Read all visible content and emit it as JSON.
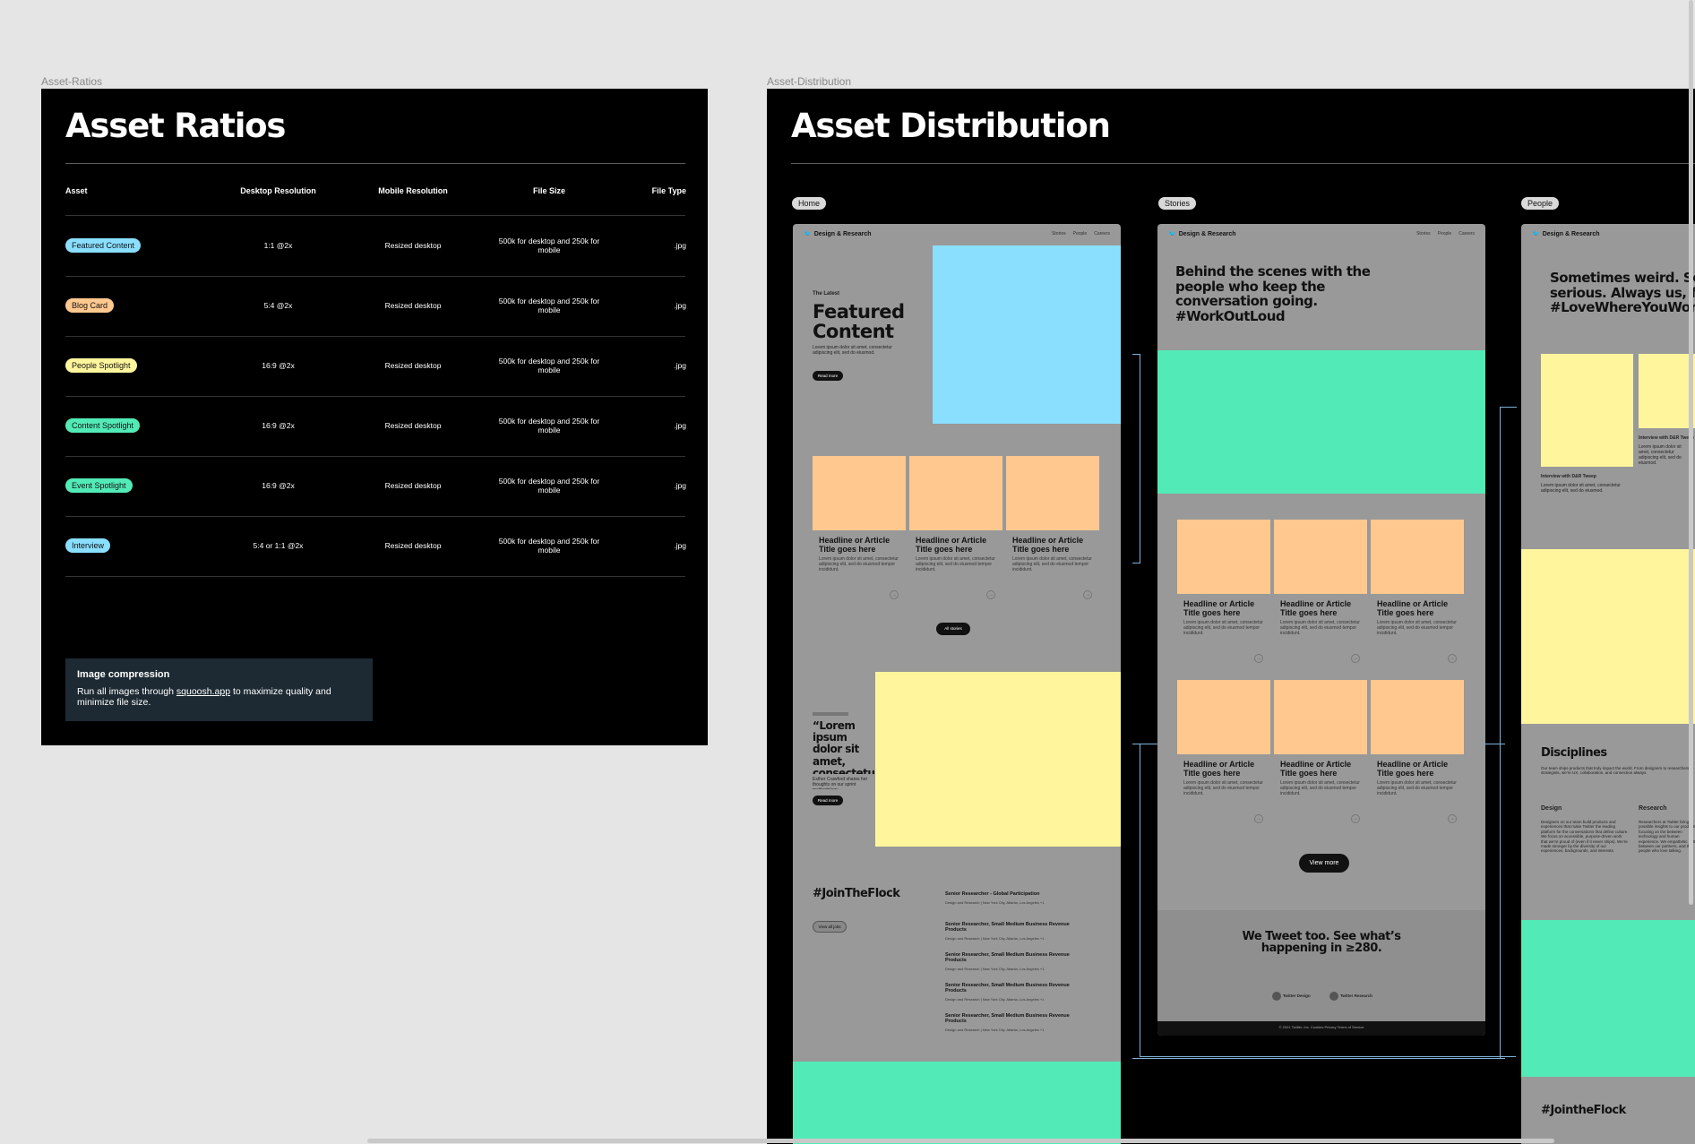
{
  "ratios_frame": {
    "label": "Asset-Ratios",
    "title": "Asset Ratios",
    "columns": [
      "Asset",
      "Desktop Resolution",
      "Mobile Resolution",
      "File Size",
      "File Type"
    ],
    "rows": [
      {
        "asset": "Featured Content",
        "color": "#8adfff",
        "desktop": "1:1 @2x",
        "mobile": "Resized desktop",
        "size": "500k for desktop and 250k for mobile",
        "type": ".jpg"
      },
      {
        "asset": "Blog Card",
        "color": "#ffc88f",
        "desktop": "5:4 @2x",
        "mobile": "Resized desktop",
        "size": "500k for desktop and 250k for mobile",
        "type": ".jpg"
      },
      {
        "asset": "People Spotlight",
        "color": "#fff59d",
        "desktop": "16:9 @2x",
        "mobile": "Resized desktop",
        "size": "500k for desktop and 250k for mobile",
        "type": ".jpg"
      },
      {
        "asset": "Content Spotlight",
        "color": "#52ebb7",
        "desktop": "16:9 @2x",
        "mobile": "Resized desktop",
        "size": "500k for desktop and 250k for mobile",
        "type": ".jpg"
      },
      {
        "asset": "Event Spotlight",
        "color": "#52ebb7",
        "desktop": "16:9 @2x",
        "mobile": "Resized desktop",
        "size": "500k for desktop and 250k for mobile",
        "type": ".jpg"
      },
      {
        "asset": "Interview",
        "color": "#8adfff",
        "desktop": "5:4 or 1:1 @2x",
        "mobile": "Resized desktop",
        "size": "500k for desktop and 250k for mobile",
        "type": ".jpg"
      }
    ],
    "note": {
      "heading": "Image compression",
      "text_before": "Run all images through ",
      "link": "squoosh.app",
      "text_after": " to maximize quality and minimize file size."
    }
  },
  "distribution_frame": {
    "label": "Asset-Distribution",
    "title": "Asset Distribution",
    "tabs": [
      "Home",
      "Stories",
      "People"
    ],
    "brand": "Design & Research",
    "nav_links": [
      "Stories",
      "People",
      "Careers"
    ],
    "home": {
      "eyebrow": "The Latest",
      "hero_title": "Featured Content",
      "lorem": "Lorem ipsum dolor sit amet, consectetur adipiscing elit, sed do eiusmod.",
      "read_more": "Read more",
      "card_title": "Headline or Article Title goes here",
      "card_text": "Lorem ipsum dolor sit amet, consectetur adipiscing elit, sed do eiusmod tempor incididunt.",
      "all_stories": "All stories",
      "quote": "“Lorem ipsum dolor sit amet, consectetur adipiscing elit, sed do eiusmod tempor.”",
      "quote_attr": "Esther Crawford shares her thoughts on our sprint methodology",
      "join": "#JoinTheFlock",
      "view_all": "View all jobs",
      "jobs": [
        "Senior Researcher - Global Participation",
        "Senior Researcher, Small Medium Business Revenue Products",
        "Senior Researcher, Small Medium Business Revenue Products",
        "Senior Researcher, Small Medium Business Revenue Products",
        "Senior Researcher, Small Medium Business Revenue Products"
      ],
      "job_meta": "Design and Research  |  New York City, Atlanta, Los Angeles +1"
    },
    "stories": {
      "headline": "Behind the scenes with the people who keep the conversation going. #WorkOutLoud",
      "view_more": "View more",
      "tweet": "We Tweet too. See what’s happening in ≥280.",
      "handle1": "Twitter Design",
      "handle2": "Twitter Research",
      "footer": "© 2021 Twitter, Inc.   Cookies   Privacy   Terms of Service"
    },
    "people": {
      "headline": "Sometimes weird. Sometimes serious. Always us, for every #LoveWhereYouWork",
      "interview": "Interview with D&R Tweep",
      "disciplines": "Disciplines",
      "disc_text": "Our team ships products that truly impact the world. From designers to researchers to strategists, we’re UX, collaboration, and connection always.",
      "design": "Design",
      "research": "Research",
      "design_text": "Designers on our team build products and experiences that make Twitter the leading platform for the conversations that define culture. We focus on accessible, purpose-driven work that we’re proud of (even if it never ships). We’re made stronger by the diversity of our experiences, backgrounds, and interests.",
      "research_text": "Researchers at Twitter bring possible insights to our products, focusing on the between technology and human experience. We empathetic better between our partners, and the people who love talking.",
      "join": "#JointheFlock"
    }
  }
}
